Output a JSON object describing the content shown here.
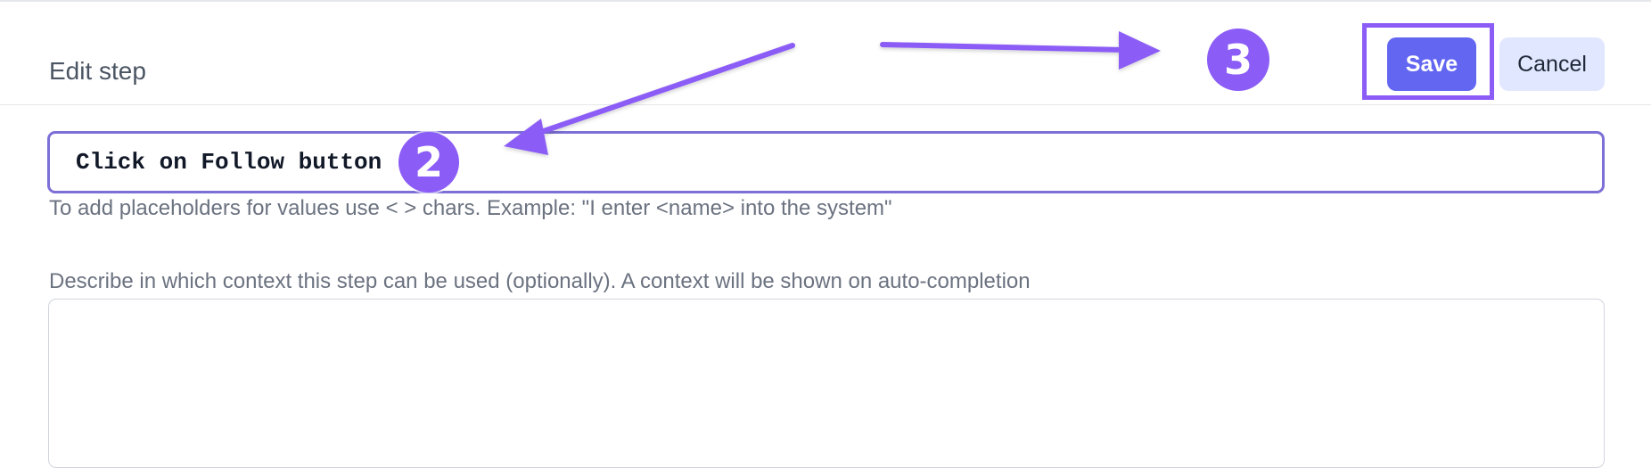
{
  "header": {
    "title": "Edit step",
    "save_label": "Save",
    "cancel_label": "Cancel"
  },
  "step_input": {
    "value": "Click on Follow button"
  },
  "hint": "To add placeholders for values use < > chars. Example: \"I enter <name> into the system\"",
  "context": {
    "label": "Describe in which context this step can be used (optionally). A context will be shown on auto-completion",
    "value": ""
  },
  "annotations": {
    "badges": [
      "2",
      "3"
    ],
    "color": "#8b5cf6"
  },
  "colors": {
    "accent": "#6366f1",
    "annotation": "#8b5cf6",
    "cancel_bg": "#e0e7ff"
  }
}
